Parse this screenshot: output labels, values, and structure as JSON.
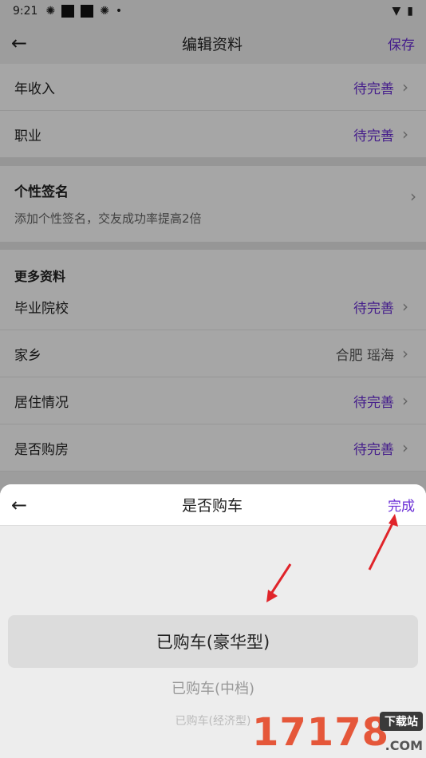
{
  "status_bar": {
    "time": "9:21"
  },
  "nav": {
    "back_icon": "arrow-left-icon",
    "title": "编辑资料",
    "save": "保存"
  },
  "rows_top": [
    {
      "label": "年收入",
      "value": "待完善"
    },
    {
      "label": "职业",
      "value": "待完善"
    }
  ],
  "signature": {
    "title": "个性签名",
    "subtitle": "添加个性签名，交友成功率提高2倍"
  },
  "more": {
    "heading": "更多资料",
    "rows": [
      {
        "label": "毕业院校",
        "value": "待完善"
      },
      {
        "label": "家乡",
        "value": "合肥 瑶海"
      },
      {
        "label": "居住情况",
        "value": "待完善"
      },
      {
        "label": "是否购房",
        "value": "待完善"
      }
    ]
  },
  "sheet": {
    "title": "是否购车",
    "done": "完成",
    "options": [
      "已购车(豪华型)",
      "已购车(中档)",
      "已购车(经济型)"
    ]
  },
  "watermark": {
    "number": "17178",
    "tag": "下载站",
    "domain": ".COM"
  },
  "colors": {
    "accent": "#6b2fd6",
    "arrow": "#e0242a"
  }
}
